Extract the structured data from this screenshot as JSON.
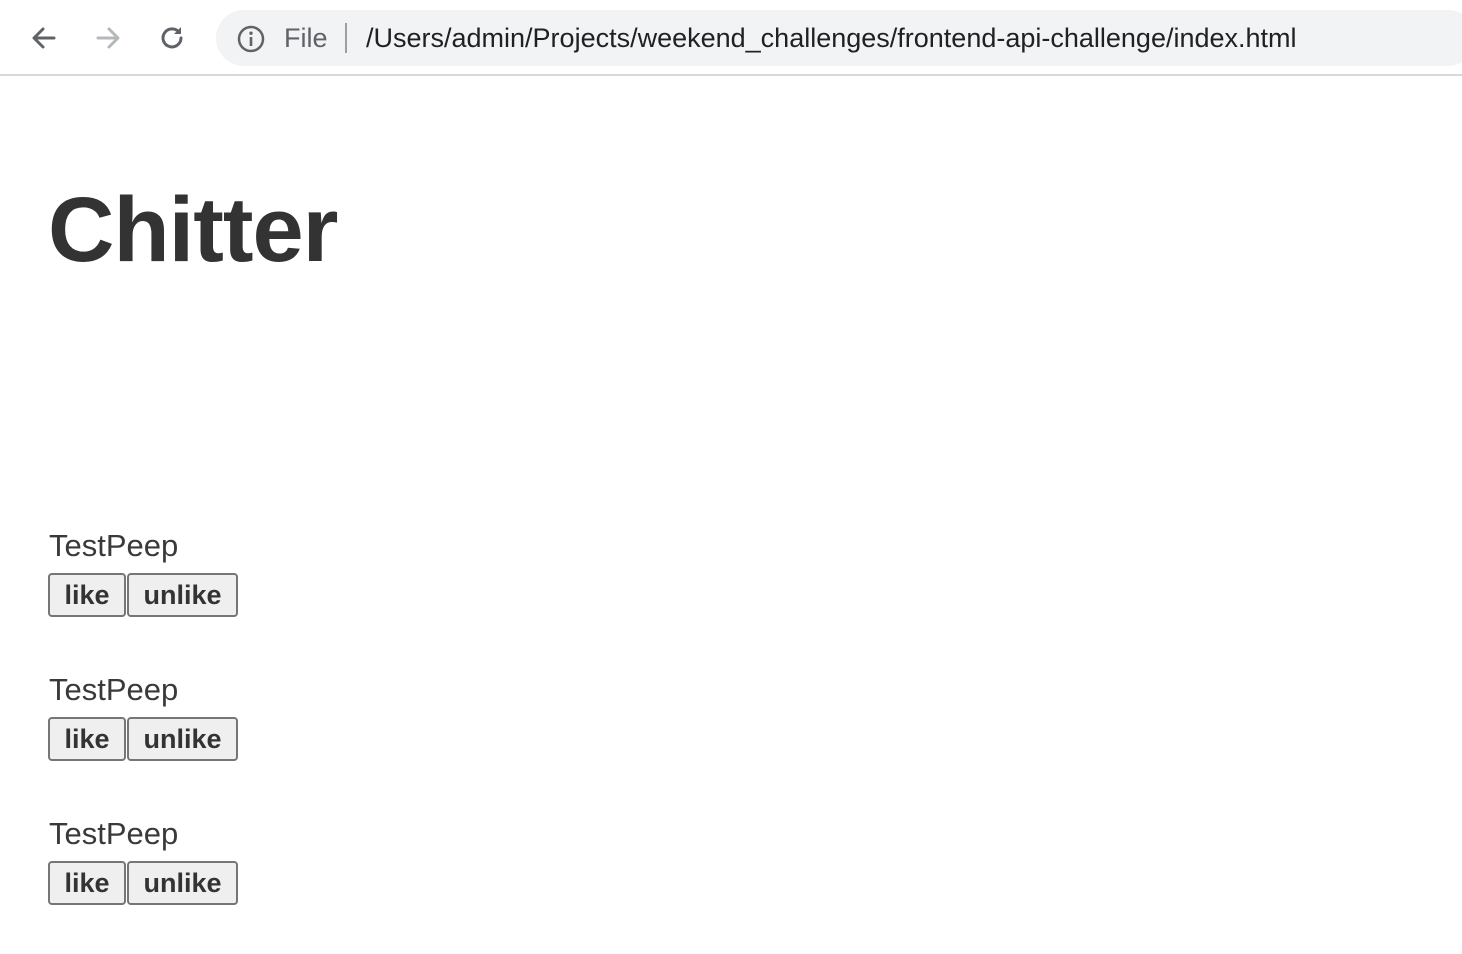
{
  "browser": {
    "address_scheme": "File",
    "address_url": "/Users/admin/Projects/weekend_challenges/frontend-api-challenge/index.html",
    "back_icon": "arrow-left-icon",
    "forward_icon": "arrow-right-icon",
    "reload_icon": "reload-icon",
    "info_icon": "info-icon"
  },
  "page": {
    "title": "Chitter"
  },
  "peeps": [
    {
      "author": "TestPeep",
      "like_label": "like",
      "unlike_label": "unlike"
    },
    {
      "author": "TestPeep",
      "like_label": "like",
      "unlike_label": "unlike"
    },
    {
      "author": "TestPeep",
      "like_label": "like",
      "unlike_label": "unlike"
    }
  ]
}
